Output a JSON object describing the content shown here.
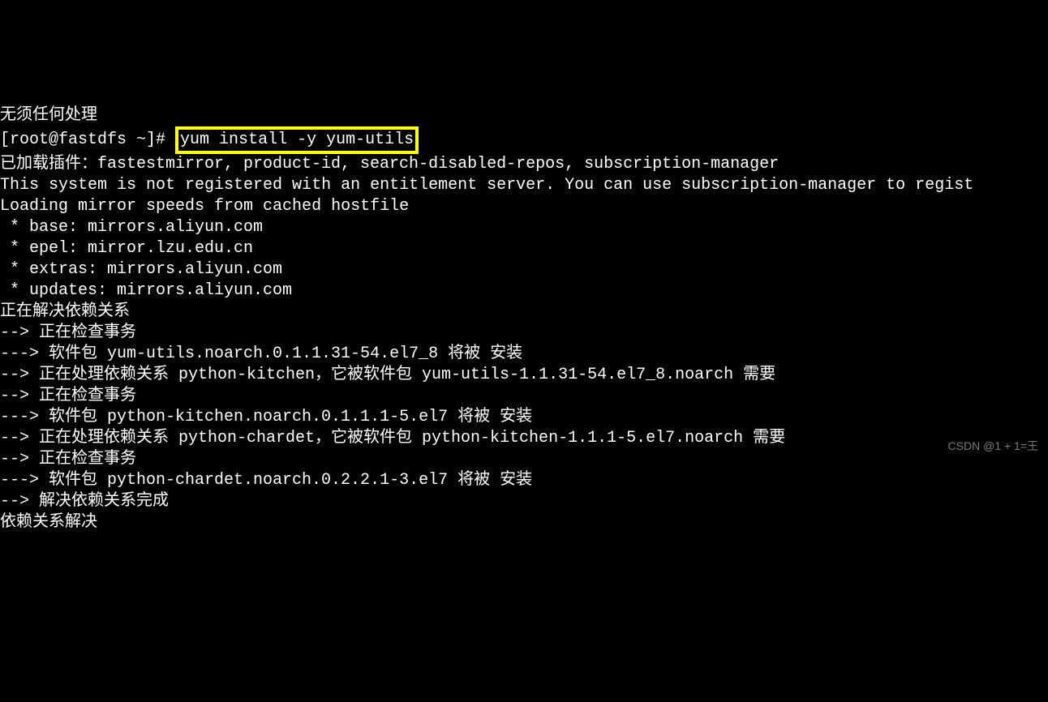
{
  "terminal": {
    "line0": "无须任何处理",
    "prompt_prefix": "[root@fastdfs ~]# ",
    "command": "yum install -y yum-utils",
    "line2": "已加载插件：fastestmirror, product-id, search-disabled-repos, subscription-manager",
    "line3": "",
    "line4": "This system is not registered with an entitlement server. You can use subscription-manager to regist",
    "line5": "",
    "line6": "Loading mirror speeds from cached hostfile",
    "line7": " * base: mirrors.aliyun.com",
    "line8": " * epel: mirror.lzu.edu.cn",
    "line9": " * extras: mirrors.aliyun.com",
    "line10": " * updates: mirrors.aliyun.com",
    "line11": "正在解决依赖关系",
    "line12": "--> 正在检查事务",
    "line13": "---> 软件包 yum-utils.noarch.0.1.1.31-54.el7_8 将被 安装",
    "line14": "--> 正在处理依赖关系 python-kitchen，它被软件包 yum-utils-1.1.31-54.el7_8.noarch 需要",
    "line15": "--> 正在检查事务",
    "line16": "---> 软件包 python-kitchen.noarch.0.1.1.1-5.el7 将被 安装",
    "line17": "--> 正在处理依赖关系 python-chardet，它被软件包 python-kitchen-1.1.1-5.el7.noarch 需要",
    "line18": "--> 正在检查事务",
    "line19": "---> 软件包 python-chardet.noarch.0.2.2.1-3.el7 将被 安装",
    "line20": "--> 解决依赖关系完成",
    "line21": "",
    "line22": "依赖关系解决"
  },
  "watermark": "CSDN @1 + 1=王"
}
